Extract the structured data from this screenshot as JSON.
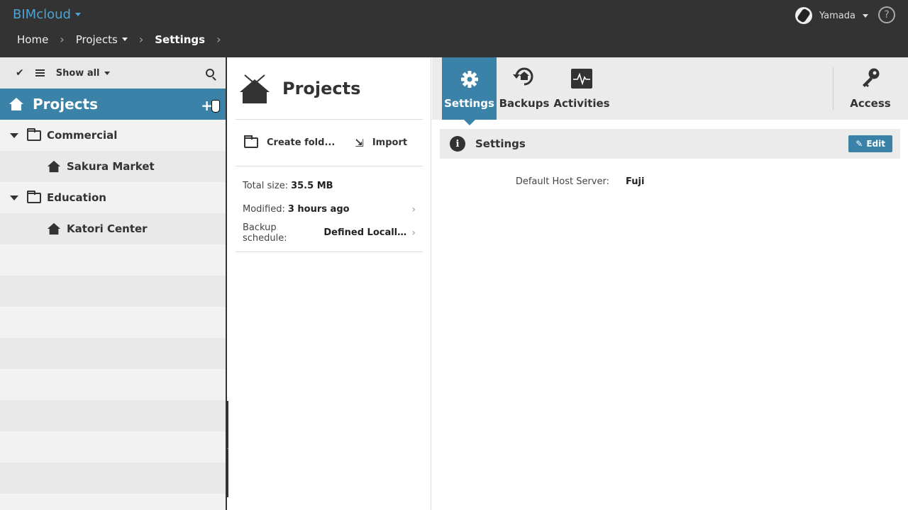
{
  "app": {
    "brand": "BIMcloud"
  },
  "breadcrumb": {
    "items": [
      {
        "label": "Home",
        "dropdown": false,
        "current": false
      },
      {
        "label": "Projects",
        "dropdown": true,
        "current": false
      },
      {
        "label": "Settings",
        "dropdown": false,
        "current": true
      }
    ]
  },
  "user": {
    "name": "Yamada",
    "help": "?"
  },
  "sidebar": {
    "toolbar": {
      "filter_label": "Show all"
    },
    "selected": {
      "label": "Projects",
      "add": "+"
    },
    "tree": [
      {
        "type": "folder",
        "label": "Commercial"
      },
      {
        "type": "project",
        "label": "Sakura Market"
      },
      {
        "type": "folder",
        "label": "Education"
      },
      {
        "type": "project",
        "label": "Katori Center"
      }
    ]
  },
  "middle": {
    "title": "Projects",
    "actions": {
      "create_folder": "Create fold...",
      "import": "Import"
    },
    "info": {
      "total_size_label": "Total size:",
      "total_size_value": "35.5 MB",
      "modified_label": "Modified:",
      "modified_value": "3 hours ago",
      "backup_label": "Backup schedule:",
      "backup_value": "Defined Locally /..."
    }
  },
  "right": {
    "tabs": [
      {
        "label": "Settings",
        "icon": "gear-icon",
        "active": true
      },
      {
        "label": "Backups",
        "icon": "backup-icon",
        "active": false
      },
      {
        "label": "Activities",
        "icon": "activity-icon",
        "active": false
      },
      {
        "label": "Access",
        "icon": "key-icon",
        "active": false
      }
    ],
    "section": {
      "title": "Settings",
      "edit_label": "Edit"
    },
    "fields": {
      "default_host_label": "Default Host Server:",
      "default_host_value": "Fuji"
    }
  },
  "colors": {
    "accent": "#3a82a8",
    "topbar": "#333333",
    "brand": "#4da3d4"
  }
}
